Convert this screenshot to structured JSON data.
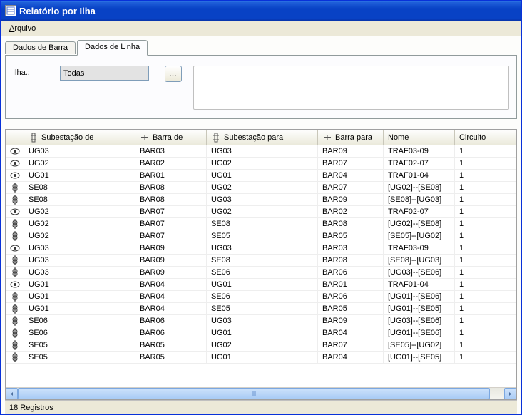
{
  "window": {
    "title": "Relatório por Ilha"
  },
  "menu": {
    "arquivo": "Arquivo",
    "arquivo_key": "A"
  },
  "tabs": {
    "barra": "Dados de Barra",
    "linha": "Dados de Linha"
  },
  "filter": {
    "label": "Ilha.:",
    "value": "Todas",
    "button": "..."
  },
  "columns": {
    "sub_de": "Subestação de",
    "barra_de": "Barra de",
    "sub_para": "Subestação para",
    "barra_para": "Barra para",
    "nome": "Nome",
    "circuito": "Circuito"
  },
  "rows": [
    {
      "icon": "eye",
      "sub_de": "UG03",
      "barra_de": "BAR03",
      "sub_para": "UG03",
      "barra_para": "BAR09",
      "nome": "TRAF03-09",
      "circ": "1"
    },
    {
      "icon": "eye",
      "sub_de": "UG02",
      "barra_de": "BAR02",
      "sub_para": "UG02",
      "barra_para": "BAR07",
      "nome": "TRAF02-07",
      "circ": "1"
    },
    {
      "icon": "eye",
      "sub_de": "UG01",
      "barra_de": "BAR01",
      "sub_para": "UG01",
      "barra_para": "BAR04",
      "nome": "TRAF01-04",
      "circ": "1"
    },
    {
      "icon": "tx",
      "sub_de": "SE08",
      "barra_de": "BAR08",
      "sub_para": "UG02",
      "barra_para": "BAR07",
      "nome": "[UG02]--[SE08]",
      "circ": "1"
    },
    {
      "icon": "tx",
      "sub_de": "SE08",
      "barra_de": "BAR08",
      "sub_para": "UG03",
      "barra_para": "BAR09",
      "nome": "[SE08]--[UG03]",
      "circ": "1"
    },
    {
      "icon": "eye",
      "sub_de": "UG02",
      "barra_de": "BAR07",
      "sub_para": "UG02",
      "barra_para": "BAR02",
      "nome": "TRAF02-07",
      "circ": "1"
    },
    {
      "icon": "tx",
      "sub_de": "UG02",
      "barra_de": "BAR07",
      "sub_para": "SE08",
      "barra_para": "BAR08",
      "nome": "[UG02]--[SE08]",
      "circ": "1"
    },
    {
      "icon": "tx",
      "sub_de": "UG02",
      "barra_de": "BAR07",
      "sub_para": "SE05",
      "barra_para": "BAR05",
      "nome": "[SE05]--[UG02]",
      "circ": "1"
    },
    {
      "icon": "eye",
      "sub_de": "UG03",
      "barra_de": "BAR09",
      "sub_para": "UG03",
      "barra_para": "BAR03",
      "nome": "TRAF03-09",
      "circ": "1"
    },
    {
      "icon": "tx",
      "sub_de": "UG03",
      "barra_de": "BAR09",
      "sub_para": "SE08",
      "barra_para": "BAR08",
      "nome": "[SE08]--[UG03]",
      "circ": "1"
    },
    {
      "icon": "tx",
      "sub_de": "UG03",
      "barra_de": "BAR09",
      "sub_para": "SE06",
      "barra_para": "BAR06",
      "nome": "[UG03]--[SE06]",
      "circ": "1"
    },
    {
      "icon": "eye",
      "sub_de": "UG01",
      "barra_de": "BAR04",
      "sub_para": "UG01",
      "barra_para": "BAR01",
      "nome": "TRAF01-04",
      "circ": "1"
    },
    {
      "icon": "tx",
      "sub_de": "UG01",
      "barra_de": "BAR04",
      "sub_para": "SE06",
      "barra_para": "BAR06",
      "nome": "[UG01]--[SE06]",
      "circ": "1"
    },
    {
      "icon": "tx",
      "sub_de": "UG01",
      "barra_de": "BAR04",
      "sub_para": "SE05",
      "barra_para": "BAR05",
      "nome": "[UG01]--[SE05]",
      "circ": "1"
    },
    {
      "icon": "tx",
      "sub_de": "SE06",
      "barra_de": "BAR06",
      "sub_para": "UG03",
      "barra_para": "BAR09",
      "nome": "[UG03]--[SE06]",
      "circ": "1"
    },
    {
      "icon": "tx",
      "sub_de": "SE06",
      "barra_de": "BAR06",
      "sub_para": "UG01",
      "barra_para": "BAR04",
      "nome": "[UG01]--[SE06]",
      "circ": "1"
    },
    {
      "icon": "tx",
      "sub_de": "SE05",
      "barra_de": "BAR05",
      "sub_para": "UG02",
      "barra_para": "BAR07",
      "nome": "[SE05]--[UG02]",
      "circ": "1"
    },
    {
      "icon": "tx",
      "sub_de": "SE05",
      "barra_de": "BAR05",
      "sub_para": "UG01",
      "barra_para": "BAR04",
      "nome": "[UG01]--[SE05]",
      "circ": "1"
    }
  ],
  "status": {
    "text": "18 Registros"
  }
}
